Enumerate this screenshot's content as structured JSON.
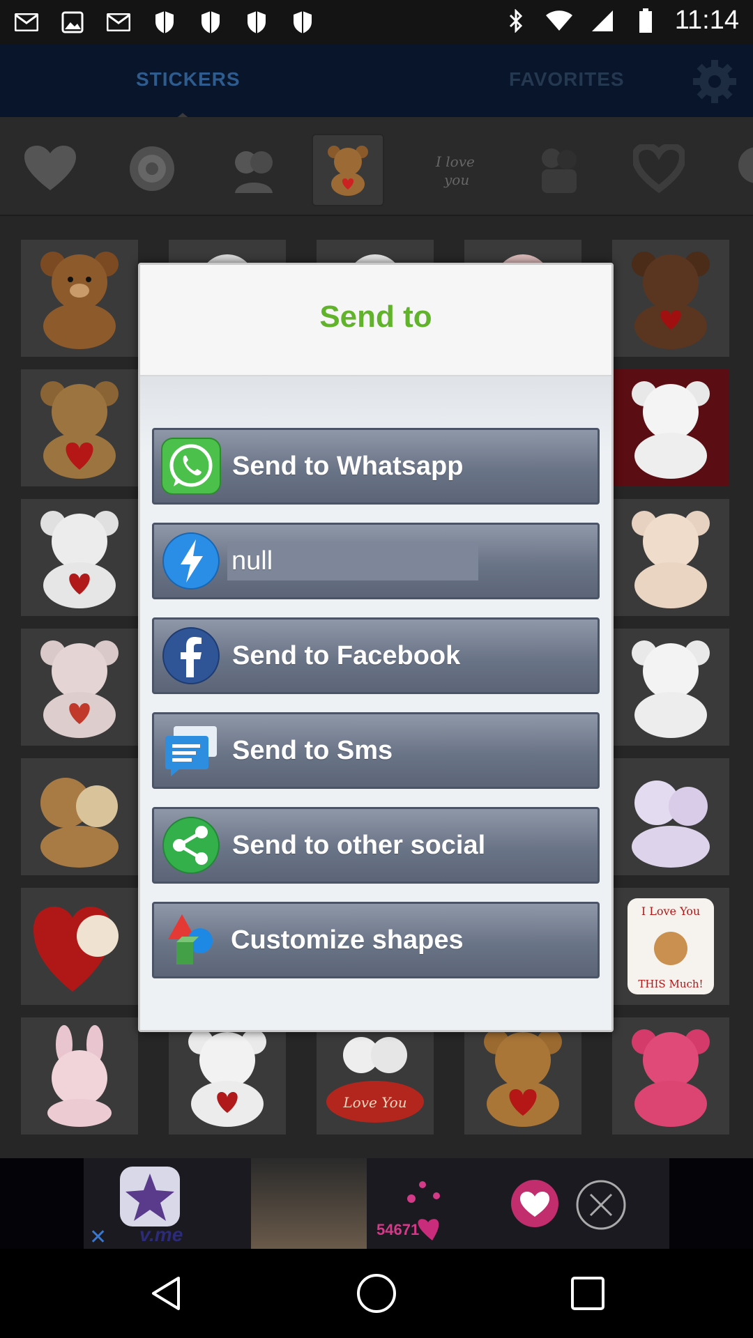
{
  "status_bar": {
    "time": "11:14",
    "icons_left": [
      "mail-icon",
      "image-icon",
      "mail-icon",
      "shield-icon",
      "shield-icon",
      "shield-icon",
      "shield-icon"
    ],
    "icons_right": [
      "bluetooth-icon",
      "wifi-icon",
      "signal-icon",
      "battery-icon"
    ]
  },
  "app_header": {
    "tabs": [
      {
        "label": "STICKERS",
        "selected": true
      },
      {
        "label": "FAVORITES",
        "selected": false
      }
    ]
  },
  "category_strip": {
    "items": [
      "heart-sticker",
      "rose-sticker",
      "couple-sticker",
      "teddy-sticker",
      "love-you-sticker",
      "kiss-sticker",
      "heart-wreath-sticker",
      "more-sticker"
    ],
    "selected_index": 3
  },
  "sticker_grid": {
    "visible_texts": [
      "Love You",
      "I Love You",
      "THIS Much!"
    ]
  },
  "ad_banner": {
    "count_text": "54671",
    "brand_text": "v.me"
  },
  "dialog": {
    "title": "Send to",
    "options": [
      {
        "label": "Send to Whatsapp",
        "icon": "whatsapp-icon"
      },
      {
        "label": "null",
        "icon": "lightning-icon"
      },
      {
        "label": "Send to Facebook",
        "icon": "facebook-icon"
      },
      {
        "label": "Send to Sms",
        "icon": "sms-icon"
      },
      {
        "label": "Send to other social",
        "icon": "share-icon"
      },
      {
        "label": "Customize shapes",
        "icon": "shapes-icon"
      }
    ]
  },
  "colors": {
    "title_green": "#62b32c",
    "option_gray": "#6a7487",
    "header_bg": "#08152b"
  }
}
